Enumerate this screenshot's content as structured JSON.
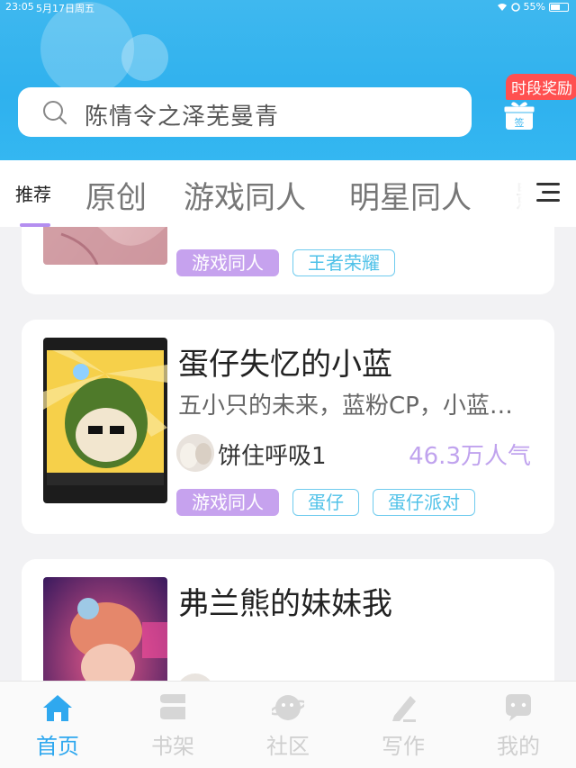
{
  "status_bar": {
    "time": "23:05",
    "date": "5月17日周五",
    "battery": "55%"
  },
  "search": {
    "text": "陈情令之泽芜曼青"
  },
  "reward": {
    "label": "时段奖励",
    "gift_text": "签"
  },
  "tabs": {
    "active": "推荐",
    "items": [
      "原创",
      "游戏同人",
      "明星同人",
      "影视"
    ]
  },
  "cards": [
    {
      "tags": [
        "游戏同人",
        "王者荣耀"
      ]
    },
    {
      "title": "蛋仔失忆的小蓝",
      "description": "五小只的未来，蓝粉CP，小蓝…",
      "author": "饼住呼吸1",
      "popularity": "46.3万人气",
      "tags": [
        "游戏同人",
        "蛋仔",
        "蛋仔派对"
      ]
    },
    {
      "title": "弗兰熊的妹妹我"
    }
  ],
  "bottom_nav": [
    {
      "label": "首页",
      "icon": "home-icon",
      "active": true
    },
    {
      "label": "书架",
      "icon": "bookshelf-icon",
      "active": false
    },
    {
      "label": "社区",
      "icon": "community-icon",
      "active": false
    },
    {
      "label": "写作",
      "icon": "write-icon",
      "active": false
    },
    {
      "label": "我的",
      "icon": "profile-icon",
      "active": false
    }
  ],
  "colors": {
    "header": "#3fb8ef",
    "accent_purple": "#c6a2ee",
    "accent_blue": "#2fa8ef",
    "popularity": "#c0a3ee"
  }
}
